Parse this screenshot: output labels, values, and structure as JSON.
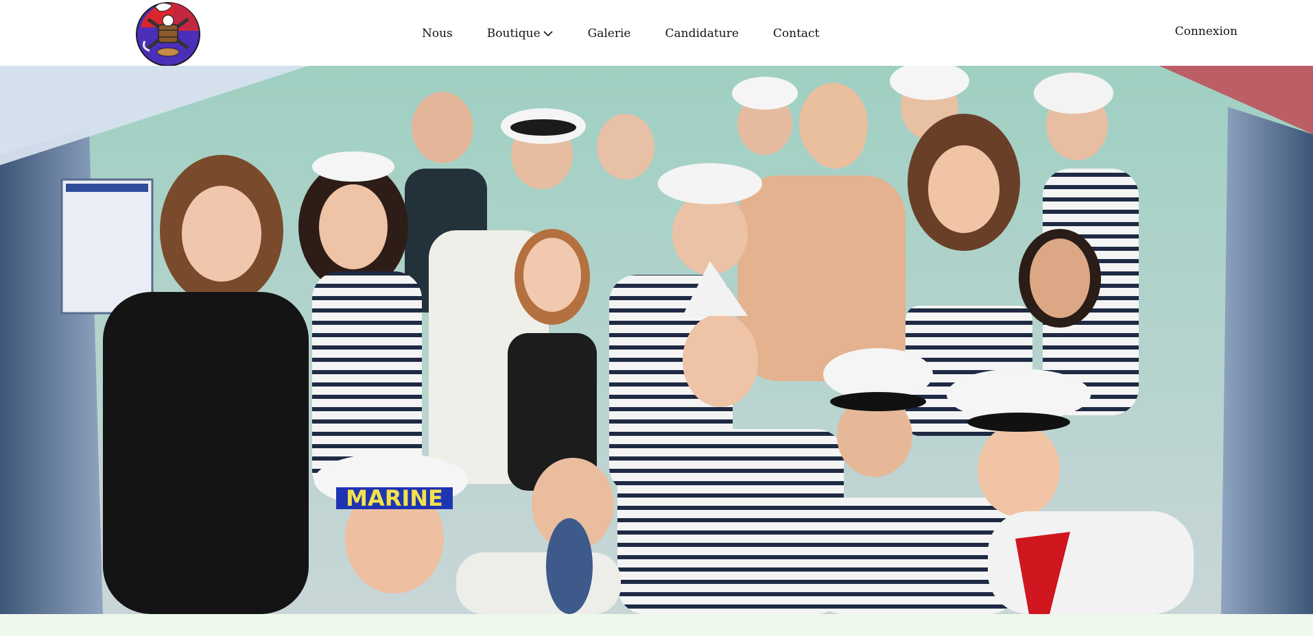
{
  "header": {
    "logo_icon": "club-mascot-logo",
    "nav": [
      {
        "label": "Nous"
      },
      {
        "label": "Boutique",
        "has_dropdown": true
      },
      {
        "label": "Galerie"
      },
      {
        "label": "Candidature"
      },
      {
        "label": "Contact"
      }
    ],
    "login_label": "Connexion"
  },
  "hero": {
    "image_icon": "group-photo-sailor-costumes",
    "hat_text": "MARINE"
  },
  "colors": {
    "text": "#141414",
    "header_bg": "#ffffff",
    "hero_wall": "#a9c7bf",
    "side_panel": "#4a6485",
    "accent_red": "#c14a56",
    "bottom_strip": "#eff8ec"
  }
}
